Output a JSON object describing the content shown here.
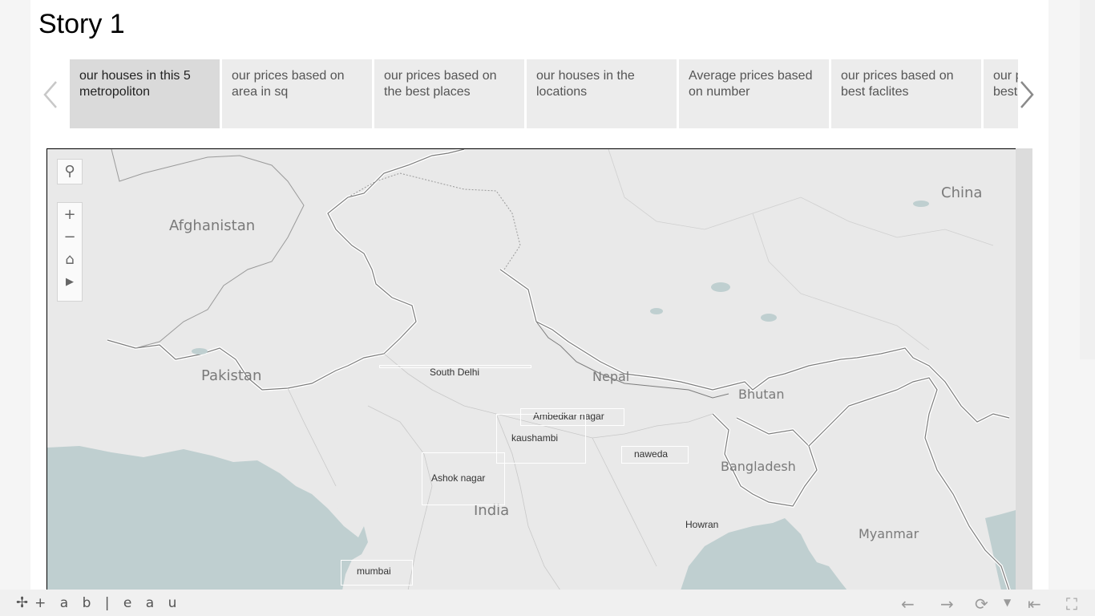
{
  "story": {
    "title": "Story 1"
  },
  "nav": {
    "tabs": [
      {
        "label": "our houses in this 5 metropoliton",
        "active": true
      },
      {
        "label": "our prices based on area in sq",
        "active": false
      },
      {
        "label": "our prices based on the best places",
        "active": false
      },
      {
        "label": "our houses in the locations",
        "active": false
      },
      {
        "label": "Average prices based on number",
        "active": false
      },
      {
        "label": "our prices based on best faclites",
        "active": false
      },
      {
        "label": "our prices based on best",
        "active": false
      }
    ],
    "prev_icon": "chevron-left-icon",
    "next_icon": "chevron-right-icon"
  },
  "map": {
    "countries": {
      "afghanistan": "Afghanistan",
      "pakistan": "Pakistan",
      "nepal": "Nepal",
      "bhutan": "Bhutan",
      "bangladesh": "Bangladesh",
      "india": "India",
      "myanmar": "Myanmar",
      "china": "China"
    },
    "cities": {
      "south_delhi": "South Delhi",
      "ambedkar_nagar": "Ambedkar nagar",
      "kaushambi": "kaushambi",
      "naweda": "naweda",
      "ashok_nagar": "Ashok nagar",
      "howran": "Howran",
      "mumbai": "mumbai"
    },
    "tools": [
      "search-icon",
      "zoom-in-icon",
      "zoom-out-icon",
      "home-icon",
      "play-icon"
    ],
    "colors": {
      "land": "#e9e9e9",
      "water": "#bfcfd0",
      "border": "#ffffff"
    }
  },
  "footer": {
    "logo": "+ a b | e a u",
    "buttons": [
      "undo-icon",
      "redo-icon",
      "revert-icon",
      "revert-dropdown-icon",
      "pause-icon",
      "fullscreen-icon"
    ]
  }
}
